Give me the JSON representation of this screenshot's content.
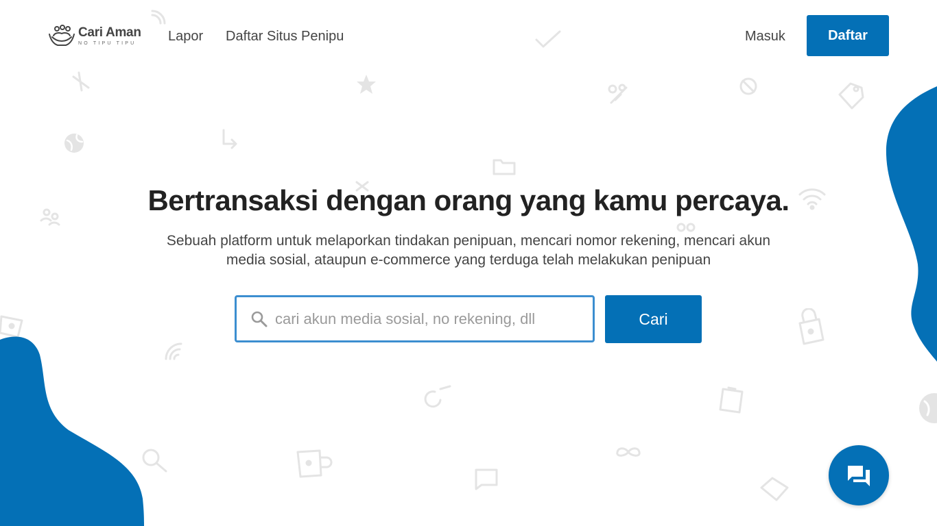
{
  "brand": {
    "name": "Cari Aman",
    "tagline": "NO TIPU TIPU",
    "accent_color": "#0470b6"
  },
  "nav": {
    "lapor": "Lapor",
    "daftar_situs_penipu": "Daftar Situs Penipu",
    "masuk": "Masuk",
    "daftar": "Daftar"
  },
  "hero": {
    "title": "Bertransaksi dengan orang yang kamu percaya.",
    "subtitle": "Sebuah platform untuk melaporkan tindakan penipuan, mencari nomor rekening, mencari akun media sosial, ataupun e-commerce yang terduga telah melakukan penipuan"
  },
  "search": {
    "placeholder": "cari akun media sosial, no rekening, dll",
    "value": "",
    "button_label": "Cari",
    "icon": "search-icon"
  },
  "chat": {
    "icon": "chat-icon"
  }
}
